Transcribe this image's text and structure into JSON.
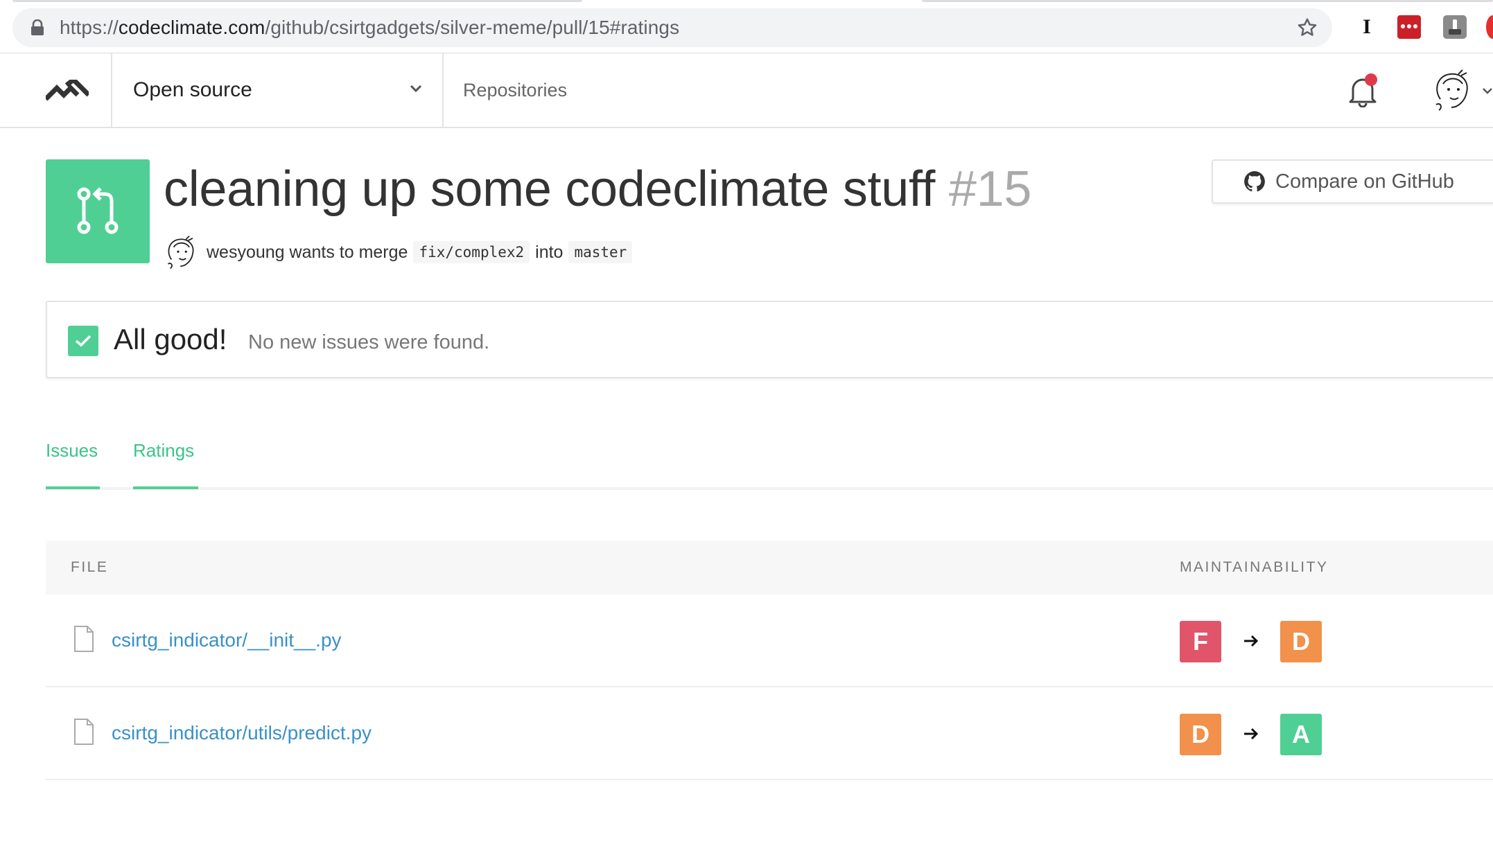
{
  "browser": {
    "url_scheme": "https://",
    "url_domain": "codeclimate.com",
    "url_path": "/github/csirtgadgets/silver-meme/pull/15#ratings",
    "ext_i_label": "I"
  },
  "nav": {
    "org_name": "Open source",
    "repos_label": "Repositories"
  },
  "pr": {
    "title": "cleaning up some codeclimate stuff",
    "number": "#15",
    "author_text": "wesyoung wants to merge",
    "source_branch": "fix/complex2",
    "into_text": "into",
    "target_branch": "master",
    "compare_label": "Compare on GitHub"
  },
  "status": {
    "title": "All good!",
    "description": "No new issues were found."
  },
  "tabs": [
    {
      "label": "Issues"
    },
    {
      "label": "Ratings"
    }
  ],
  "table": {
    "headers": {
      "file": "FILE",
      "maintainability": "MAINTAINABILITY"
    },
    "rows": [
      {
        "file": "csirtg_indicator/__init__.py",
        "from_grade": "F",
        "to_grade": "D",
        "from_color": "#e0556a",
        "to_color": "#f1914b"
      },
      {
        "file": "csirtg_indicator/utils/predict.py",
        "from_grade": "D",
        "to_grade": "A",
        "from_color": "#f1914b",
        "to_color": "#4fcf94"
      }
    ]
  },
  "colors": {
    "accent_green": "#4fcf94",
    "link_blue": "#3a90c9",
    "grade_f": "#e0556a",
    "grade_d": "#f1914b",
    "grade_a": "#4fcf94"
  }
}
